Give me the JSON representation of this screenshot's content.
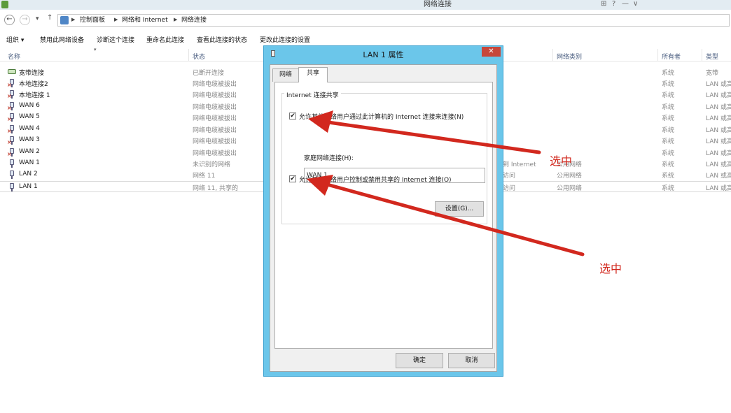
{
  "window": {
    "title": "网络连接",
    "controls": [
      "⊞",
      "?",
      "—",
      "∨"
    ]
  },
  "address": {
    "back": "←",
    "forward": "→",
    "dropdown": "▾",
    "up": "↑",
    "crumbs": [
      "控制面板",
      "网络和 Internet",
      "网络连接"
    ]
  },
  "toolbar": {
    "organize": "组织 ▾",
    "actions": [
      "禁用此网络设备",
      "诊断这个连接",
      "重命名此连接",
      "查看此连接的状态",
      "更改此连接的设置"
    ]
  },
  "columns": {
    "name": "名称",
    "status": "状态",
    "category": "网络类别",
    "owner": "所有者",
    "type": "类型"
  },
  "connections": [
    {
      "name": "宽带连接",
      "status": "已断开连接",
      "private": "",
      "category": "",
      "owner": "系统",
      "type": "宽带",
      "icon": "broadband-icon"
    },
    {
      "name": "本地连接2",
      "status": "网络电缆被拔出",
      "private": "",
      "category": "",
      "owner": "系统",
      "type": "LAN 或高速",
      "icon": "network-adapter-icon"
    },
    {
      "name": "本地连接 1",
      "status": "网络电缆被拔出",
      "private": "",
      "category": "",
      "owner": "系统",
      "type": "LAN 或高速",
      "icon": "network-adapter-icon"
    },
    {
      "name": "WAN 6",
      "status": "网络电缆被拔出",
      "private": "",
      "category": "",
      "owner": "系统",
      "type": "LAN 或高速",
      "icon": "network-adapter-icon"
    },
    {
      "name": "WAN 5",
      "status": "网络电缆被拔出",
      "private": "",
      "category": "",
      "owner": "系统",
      "type": "LAN 或高速",
      "icon": "network-adapter-icon"
    },
    {
      "name": "WAN 4",
      "status": "网络电缆被拔出",
      "private": "",
      "category": "",
      "owner": "系统",
      "type": "LAN 或高速",
      "icon": "network-adapter-icon"
    },
    {
      "name": "WAN 3",
      "status": "网络电缆被拔出",
      "private": "",
      "category": "",
      "owner": "系统",
      "type": "LAN 或高速",
      "icon": "network-adapter-icon"
    },
    {
      "name": "WAN 2",
      "status": "网络电缆被拔出",
      "private": "",
      "category": "",
      "owner": "系统",
      "type": "LAN 或高速",
      "icon": "network-adapter-icon"
    },
    {
      "name": "WAN 1",
      "status": "未识别的网络",
      "private": "到 Internet",
      "category": "公用网络",
      "owner": "系统",
      "type": "LAN 或高速",
      "icon": "network-adapter-icon"
    },
    {
      "name": "LAN 2",
      "status": "网络 11",
      "private": "访问",
      "category": "公用网络",
      "owner": "系统",
      "type": "LAN 或高速",
      "icon": "network-adapter-icon"
    },
    {
      "name": "LAN 1",
      "status": "网络 11, 共享的",
      "private": "访问",
      "category": "公用网络",
      "owner": "系统",
      "type": "LAN 或高速",
      "icon": "network-adapter-icon"
    }
  ],
  "dialog": {
    "title": "LAN 1 属性",
    "close": "✕",
    "tabs": [
      "网络",
      "共享"
    ],
    "group_title": "Internet 连接共享",
    "allow_share_label": "允许其他网络用户通过此计算机的 Internet 连接来连接(N)",
    "allow_share_checked": true,
    "home_net_label": "家庭网络连接(H):",
    "home_net_value": "WAN 1",
    "allow_control_label": "允许其他网络用户控制或禁用共享的 Internet 连接(O)",
    "allow_control_checked": true,
    "settings_button": "设置(G)...",
    "ok_button": "确定",
    "cancel_button": "取消"
  },
  "annotations": [
    "选中",
    "选中"
  ],
  "colors": {
    "dialog_frame": "#6bc6ea",
    "close_button": "#c7473b",
    "annotation": "#d2281e"
  }
}
